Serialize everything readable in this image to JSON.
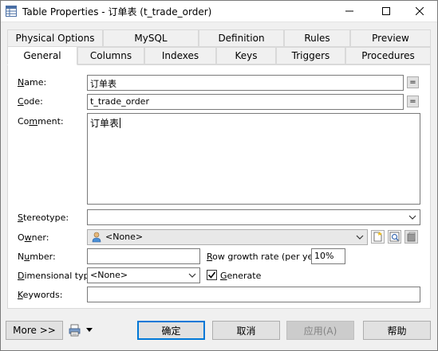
{
  "window": {
    "title": "Table Properties - 订单表 (t_trade_order)",
    "icon": "table-icon"
  },
  "tabs_row1": [
    "Physical Options",
    "MySQL",
    "Definition",
    "Rules",
    "Preview"
  ],
  "tabs_row2": [
    "General",
    "Columns",
    "Indexes",
    "Keys",
    "Triggers",
    "Procedures"
  ],
  "active_tab": "General",
  "form": {
    "name_label_key": "N",
    "name_label_rest": "ame:",
    "name_value": "订单表",
    "code_label_key": "C",
    "code_label_rest": "ode:",
    "code_value": "t_trade_order",
    "comment_label_pre": "Co",
    "comment_label_key": "m",
    "comment_label_rest": "ment:",
    "comment_value": "订单表",
    "eq_button": "=",
    "stereotype_label_key": "S",
    "stereotype_label_rest": "tereotype:",
    "stereotype_value": "",
    "owner_label_pre": "O",
    "owner_label_key": "w",
    "owner_label_rest": "ner:",
    "owner_value": "<None>",
    "number_label_pre": "N",
    "number_label_key": "u",
    "number_label_rest": "mber:",
    "number_value": "",
    "row_growth_label_key": "R",
    "row_growth_label_rest": "ow growth rate (per year):",
    "row_growth_value": "10%",
    "dimensional_label_pre": "",
    "dimensional_label_key": "D",
    "dimensional_label_rest": "imensional type:",
    "dimensional_value": "<None>",
    "generate_label_key": "G",
    "generate_label_rest": "enerate",
    "generate_checked": true,
    "keywords_label_key": "K",
    "keywords_label_rest": "eywords:",
    "keywords_value": ""
  },
  "footer": {
    "more": "More >>",
    "ok": "确定",
    "cancel": "取消",
    "apply": "应用(A)",
    "help": "帮助"
  }
}
